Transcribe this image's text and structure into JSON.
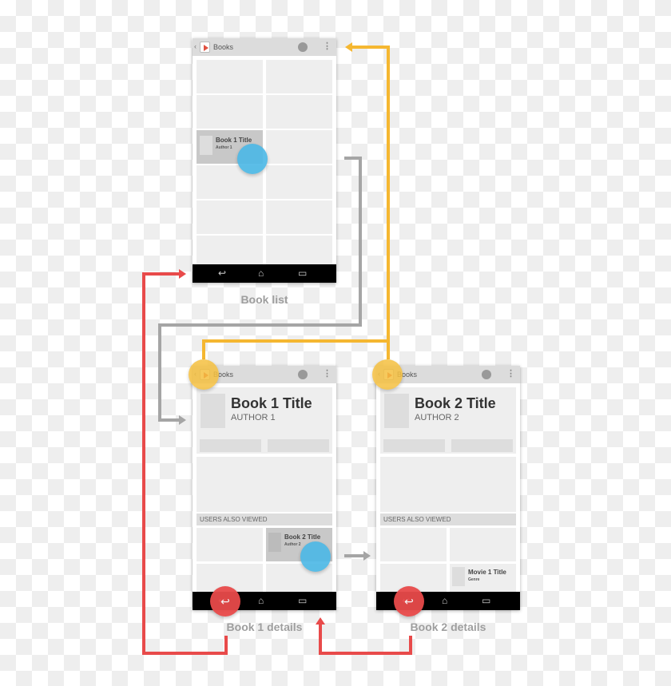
{
  "colors": {
    "forward": "#a5a5a5",
    "up": "#f5b731",
    "back": "#e84a4a",
    "touch_tap": "#4bb8e6"
  },
  "icons": {
    "app": "play-store-icon",
    "back": "back-icon",
    "home": "home-icon",
    "recents": "recents-icon",
    "overflow": "more-vert-icon"
  },
  "screens": [
    {
      "label": "Book list",
      "app_title": "Books",
      "item": {
        "title": "Book 1 Title",
        "subtitle": "Author 1"
      }
    },
    {
      "label": "Book 1 details",
      "app_title": "Books",
      "title": "Book 1 Title",
      "author": "AUTHOR 1",
      "section": "USERS ALSO VIEWED",
      "item": {
        "title": "Book 2 Title",
        "subtitle": "Author 2"
      }
    },
    {
      "label": "Book 2 details",
      "app_title": "Books",
      "title": "Book 2 Title",
      "author": "AUTHOR 2",
      "section": "USERS ALSO VIEWED",
      "item": {
        "title": "Movie 1 Title",
        "subtitle": "Genre"
      }
    }
  ]
}
